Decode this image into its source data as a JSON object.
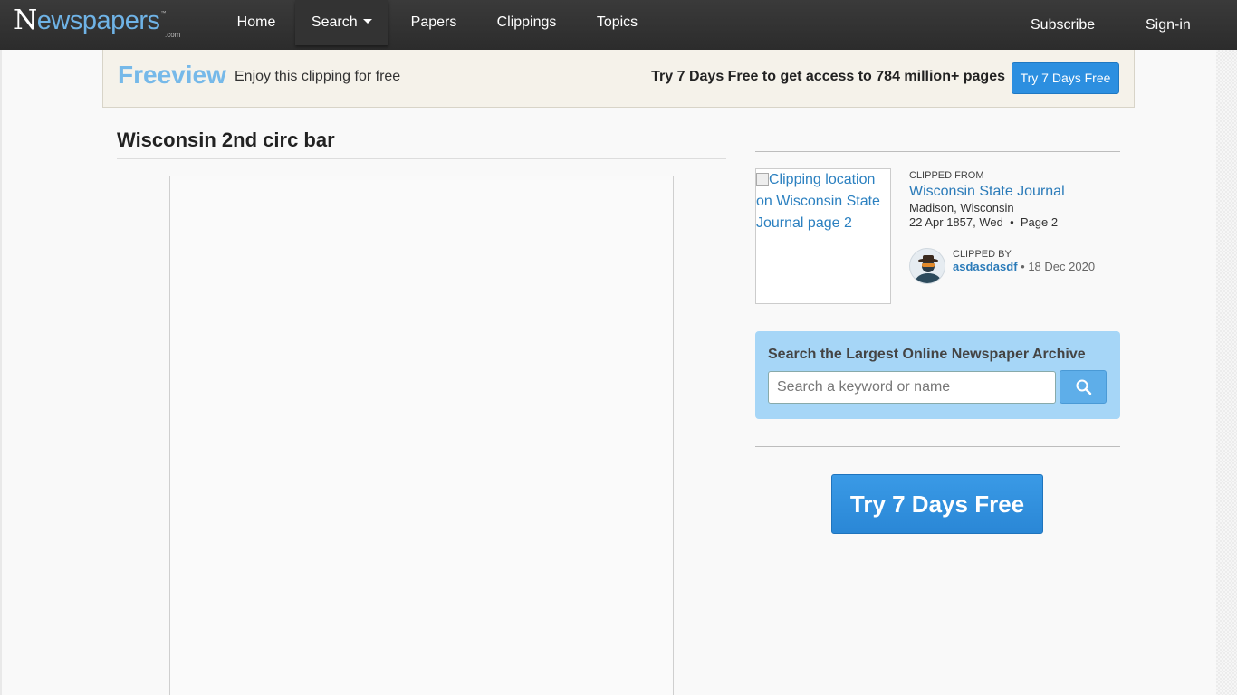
{
  "brand": {
    "logo_first": "N",
    "logo_rest": "ewspapers",
    "logo_tm": "™",
    "logo_com": ".com"
  },
  "nav": {
    "home": "Home",
    "search": "Search",
    "papers": "Papers",
    "clippings": "Clippings",
    "topics": "Topics",
    "subscribe": "Subscribe",
    "signin": "Sign-in"
  },
  "freeview": {
    "title": "Freeview",
    "subtitle": "Enjoy this clipping for free",
    "offer": "Try 7 Days Free to get access to 784 million+ pages",
    "button": "Try 7 Days Free"
  },
  "clipping": {
    "title": "Wisconsin 2nd circ bar"
  },
  "sidebar": {
    "thumb_alt": "Clipping location on Wisconsin State Journal page 2",
    "clipped_from_label": "CLIPPED FROM",
    "paper": "Wisconsin State Journal",
    "location": "Madison, Wisconsin",
    "date": "22 Apr 1857, Wed",
    "page": "Page 2",
    "clipped_by_label": "CLIPPED BY",
    "user": "asdasdasdf",
    "clip_date": "18 Dec 2020",
    "search_title": "Search the Largest Online Newspaper Archive",
    "search_placeholder": "Search a keyword or name",
    "cta": "Try 7 Days Free"
  },
  "colors": {
    "accent": "#2c8fe0",
    "freeview": "#76b9e9",
    "search_panel": "#a6d6f7",
    "link": "#2b7bb9"
  }
}
